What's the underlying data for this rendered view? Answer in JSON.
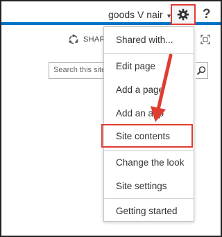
{
  "suite_bar": {
    "user_name": "goods V nair",
    "help_label": "?"
  },
  "ribbon": {
    "share_label": "SHARE"
  },
  "search": {
    "placeholder": "Search this site"
  },
  "settings_menu": {
    "items": [
      {
        "label": "Shared with..."
      },
      {
        "label": "Edit page"
      },
      {
        "label": "Add a page"
      },
      {
        "label": "Add an app"
      },
      {
        "label": "Site contents"
      },
      {
        "label": "Change the look"
      },
      {
        "label": "Site settings"
      },
      {
        "label": "Getting started"
      }
    ]
  },
  "annotation": {
    "highlight_color": "#e03c31",
    "accent_color": "#0072c6"
  }
}
